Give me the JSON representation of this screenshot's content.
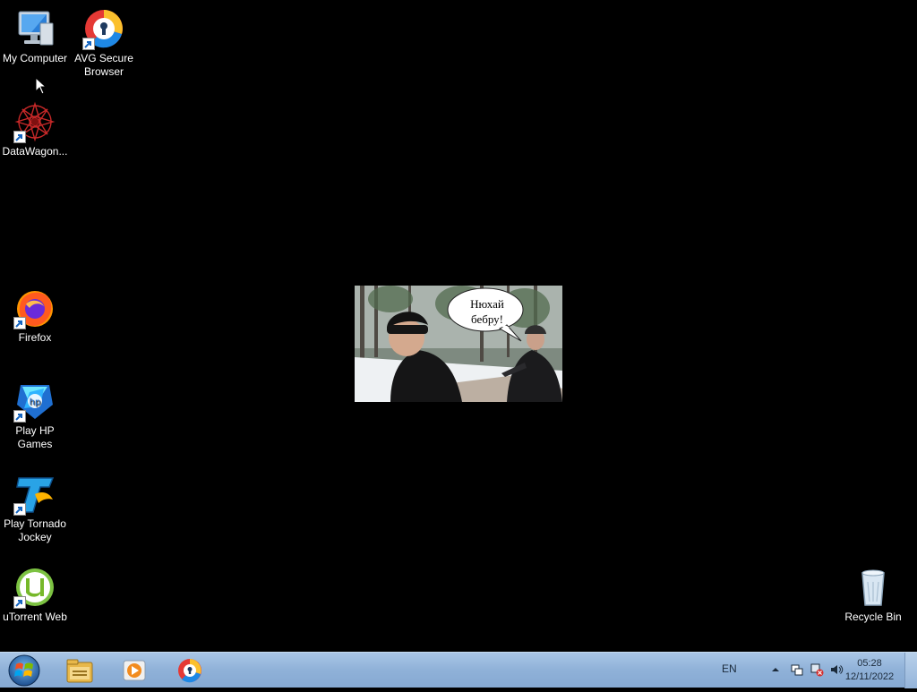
{
  "desktop": {
    "icons": [
      {
        "label": "My Computer",
        "icon": "computer-icon"
      },
      {
        "label": "AVG Secure Browser",
        "icon": "avg-browser-icon"
      },
      {
        "label": "DataWagon...",
        "icon": "datawagon-icon"
      },
      {
        "label": "Firefox",
        "icon": "firefox-icon"
      },
      {
        "label": "Play HP Games",
        "icon": "hp-games-icon"
      },
      {
        "label": "Play Tornado Jockey",
        "icon": "tornado-jockey-icon"
      },
      {
        "label": "uTorrent Web",
        "icon": "utorrent-icon"
      },
      {
        "label": "Recycle Bin",
        "icon": "recycle-bin-icon"
      }
    ],
    "wallpaper": {
      "bubble_line1": "Нюхай",
      "bubble_line2": "бебру!"
    }
  },
  "taskbar": {
    "start": "start-orb-icon",
    "pinned": [
      "file-explorer-icon",
      "media-player-icon",
      "avg-browser-icon"
    ],
    "tray": {
      "language": "EN",
      "time": "05:28",
      "date": "12/11/2022"
    }
  },
  "colors": {
    "desktop_bg": "#000000",
    "taskbar": "#8fb1d8",
    "icon_text": "#ffffff"
  }
}
